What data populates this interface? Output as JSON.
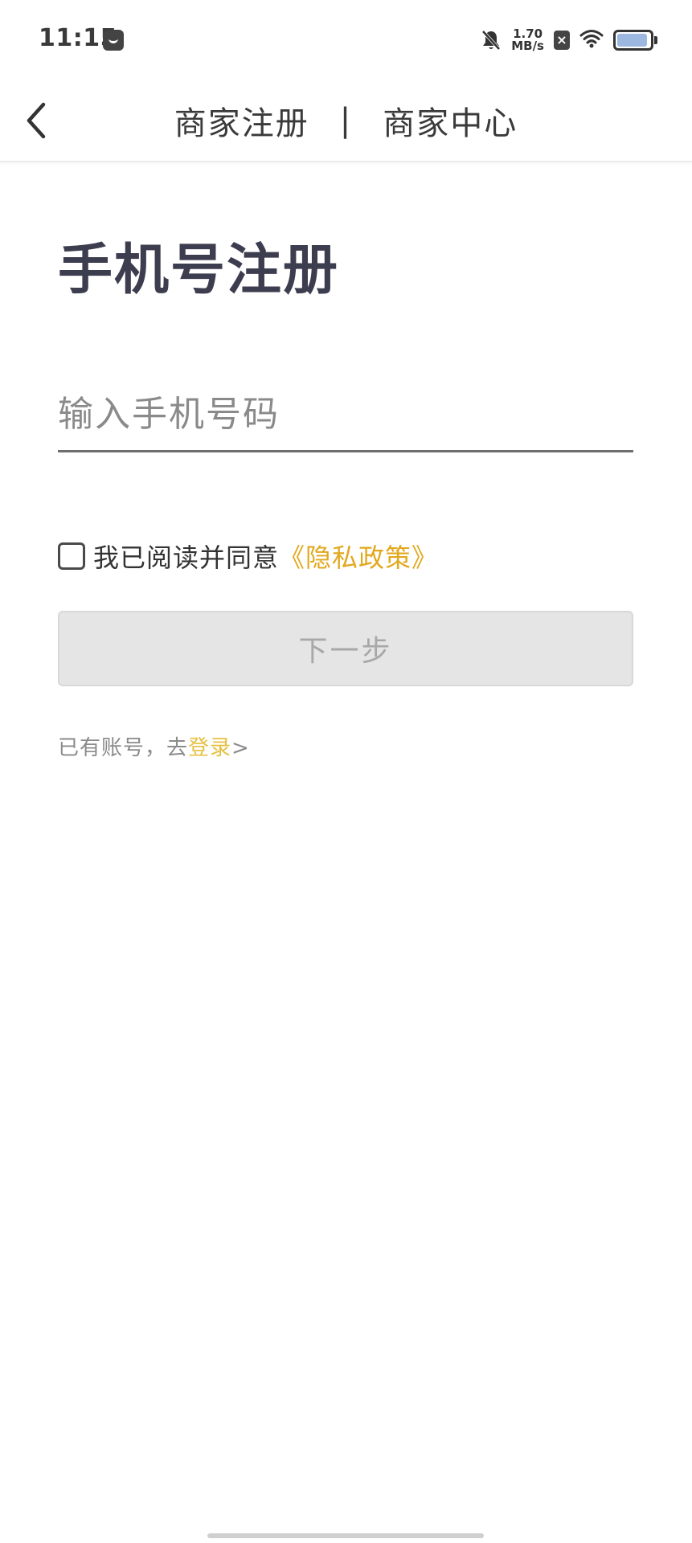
{
  "status_bar": {
    "time": "11:15",
    "net_speed_value": "1.70",
    "net_speed_unit": "MB/s",
    "battery_level": 0.92,
    "icons": [
      "app-notification-icon",
      "mute-bell-icon",
      "sim-x-icon",
      "wifi-icon",
      "battery-icon"
    ]
  },
  "header": {
    "title_left": "商家注册",
    "separator": "|",
    "title_right": "商家中心",
    "back_icon": "chevron-left-icon"
  },
  "main": {
    "page_title": "手机号注册",
    "phone_placeholder": "输入手机号码",
    "phone_value": "",
    "agree_text": "我已阅读并同意",
    "privacy_link": "《隐私政策》",
    "agree_checked": false,
    "next_button": "下一步",
    "login_prompt": "已有账号，去",
    "login_link": "登录",
    "login_arrow": ">"
  },
  "colors": {
    "accent": "#e2a81e",
    "login_link": "#e5c040",
    "title": "#3d3d50",
    "button_disabled_bg": "#e5e5e5",
    "button_disabled_text": "#a8a8a8"
  }
}
